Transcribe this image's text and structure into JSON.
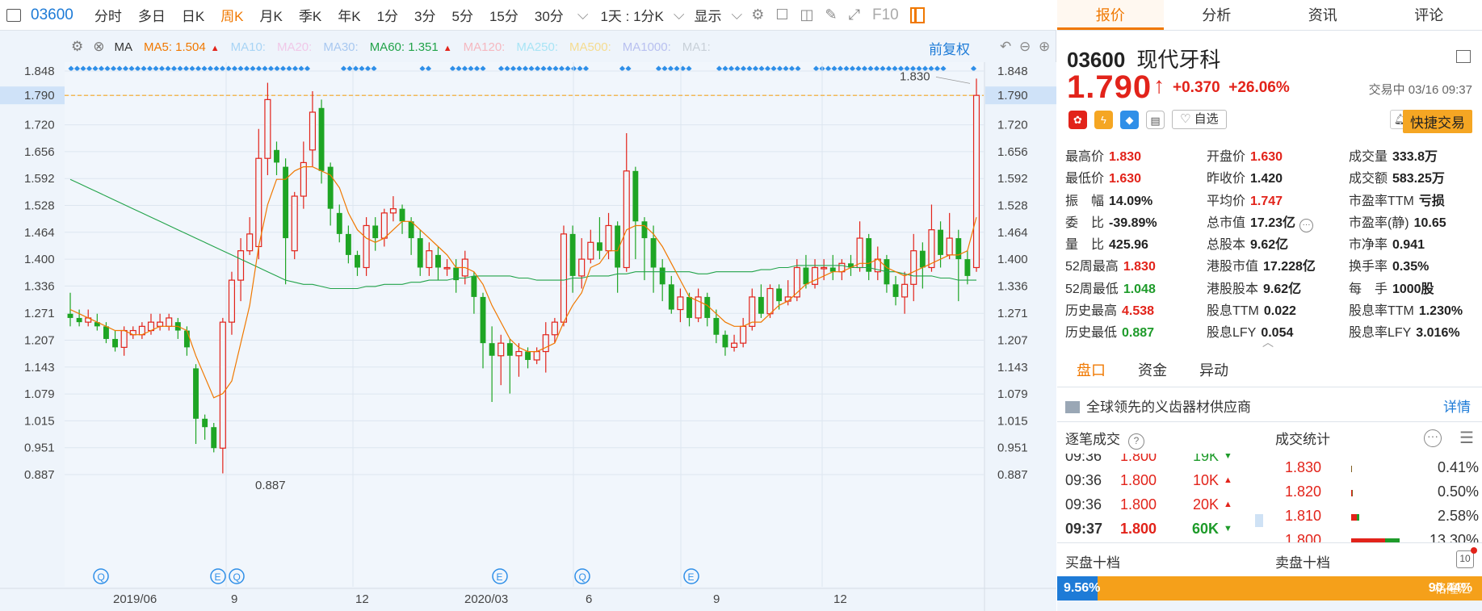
{
  "toolbar": {
    "code": "03600",
    "periods": [
      "分时",
      "多日",
      "日K",
      "周K",
      "月K",
      "季K",
      "年K",
      "1分",
      "3分",
      "5分",
      "15分",
      "30分"
    ],
    "active_period": "周K",
    "interval": "1天 : 1分K",
    "display": "显示",
    "f10": "F10"
  },
  "ma_bar": {
    "label": "MA",
    "items": [
      {
        "text": "MA5: 1.504",
        "color": "#f07800",
        "arrow": "▲"
      },
      {
        "text": "MA10:",
        "color": "#a8d4f5"
      },
      {
        "text": "MA20:",
        "color": "#f0c8e8"
      },
      {
        "text": "MA30:",
        "color": "#a8c8f0"
      },
      {
        "text": "MA60: 1.351",
        "color": "#22a34a",
        "arrow": "▲"
      },
      {
        "text": "MA120:",
        "color": "#f5b8c0"
      },
      {
        "text": "MA250:",
        "color": "#a8e4f5"
      },
      {
        "text": "MA500:",
        "color": "#f5dc90"
      },
      {
        "text": "MA1000:",
        "color": "#b8c0f0"
      },
      {
        "text": "MA1:",
        "color": "#c8d0d8"
      }
    ],
    "adjust": "前复权"
  },
  "chart_data": {
    "type": "candlestick",
    "y_axis_labels": [
      "1.848",
      "1.790",
      "1.720",
      "1.656",
      "1.592",
      "1.528",
      "1.464",
      "1.400",
      "1.336",
      "1.271",
      "1.207",
      "1.143",
      "1.079",
      "1.015",
      "0.951",
      "0.887"
    ],
    "current_price_label": "1.790",
    "high_annotation": "1.830",
    "low_annotation": "0.887",
    "x_labels": [
      "2019/06",
      "9",
      "12",
      "2020/03",
      "6",
      "9",
      "12"
    ],
    "event_markers": [
      "Q",
      "E",
      "Q",
      "E",
      "Q",
      "E"
    ],
    "ylim": [
      0.887,
      1.848
    ],
    "candles": [
      [
        1.27,
        1.26,
        1.32,
        1.24
      ],
      [
        1.26,
        1.25,
        1.28,
        1.24
      ],
      [
        1.25,
        1.26,
        1.28,
        1.24
      ],
      [
        1.25,
        1.24,
        1.27,
        1.23
      ],
      [
        1.24,
        1.21,
        1.25,
        1.2
      ],
      [
        1.21,
        1.19,
        1.23,
        1.18
      ],
      [
        1.19,
        1.23,
        1.24,
        1.17
      ],
      [
        1.22,
        1.23,
        1.24,
        1.21
      ],
      [
        1.22,
        1.24,
        1.25,
        1.21
      ],
      [
        1.23,
        1.25,
        1.27,
        1.22
      ],
      [
        1.24,
        1.25,
        1.27,
        1.23
      ],
      [
        1.24,
        1.26,
        1.27,
        1.23
      ],
      [
        1.25,
        1.23,
        1.26,
        1.21
      ],
      [
        1.23,
        1.19,
        1.24,
        1.17
      ],
      [
        1.14,
        1.02,
        1.15,
        0.96
      ],
      [
        1.02,
        1.0,
        1.03,
        0.97
      ],
      [
        1.0,
        0.95,
        1.01,
        0.94
      ],
      [
        0.95,
        1.25,
        1.26,
        0.89
      ],
      [
        1.25,
        1.35,
        1.37,
        1.22
      ],
      [
        1.35,
        1.42,
        1.45,
        1.3
      ],
      [
        1.42,
        1.46,
        1.5,
        1.41
      ],
      [
        1.43,
        1.64,
        1.71,
        1.4
      ],
      [
        1.64,
        1.78,
        1.82,
        1.6
      ],
      [
        1.66,
        1.63,
        1.68,
        1.6
      ],
      [
        1.62,
        1.45,
        1.64,
        1.34
      ],
      [
        1.42,
        1.55,
        1.56,
        1.4
      ],
      [
        1.55,
        1.63,
        1.68,
        1.52
      ],
      [
        1.66,
        1.75,
        1.8,
        1.62
      ],
      [
        1.76,
        1.61,
        1.78,
        1.58
      ],
      [
        1.62,
        1.52,
        1.63,
        1.48
      ],
      [
        1.51,
        1.46,
        1.53,
        1.44
      ],
      [
        1.46,
        1.41,
        1.48,
        1.39
      ],
      [
        1.41,
        1.38,
        1.42,
        1.36
      ],
      [
        1.38,
        1.48,
        1.5,
        1.36
      ],
      [
        1.48,
        1.45,
        1.5,
        1.42
      ],
      [
        1.45,
        1.51,
        1.52,
        1.43
      ],
      [
        1.51,
        1.52,
        1.55,
        1.49
      ],
      [
        1.52,
        1.49,
        1.53,
        1.46
      ],
      [
        1.49,
        1.45,
        1.5,
        1.41
      ],
      [
        1.45,
        1.38,
        1.47,
        1.36
      ],
      [
        1.38,
        1.42,
        1.44,
        1.36
      ],
      [
        1.41,
        1.38,
        1.43,
        1.35
      ],
      [
        1.38,
        1.38,
        1.4,
        1.36
      ],
      [
        1.38,
        1.35,
        1.4,
        1.32
      ],
      [
        1.36,
        1.4,
        1.42,
        1.34
      ],
      [
        1.36,
        1.31,
        1.37,
        1.27
      ],
      [
        1.31,
        1.2,
        1.32,
        1.14
      ],
      [
        1.2,
        1.17,
        1.24,
        1.06
      ],
      [
        1.17,
        1.2,
        1.22,
        1.1
      ],
      [
        1.2,
        1.17,
        1.21,
        1.08
      ],
      [
        1.17,
        1.18,
        1.2,
        1.12
      ],
      [
        1.18,
        1.16,
        1.19,
        1.14
      ],
      [
        1.16,
        1.18,
        1.19,
        1.15
      ],
      [
        1.18,
        1.22,
        1.25,
        1.13
      ],
      [
        1.22,
        1.25,
        1.26,
        1.2
      ],
      [
        1.25,
        1.46,
        1.48,
        1.24
      ],
      [
        1.46,
        1.36,
        1.48,
        1.32
      ],
      [
        1.36,
        1.4,
        1.45,
        1.33
      ],
      [
        1.4,
        1.44,
        1.47,
        1.39
      ],
      [
        1.44,
        1.42,
        1.5,
        1.4
      ],
      [
        1.42,
        1.48,
        1.51,
        1.4
      ],
      [
        1.48,
        1.38,
        1.49,
        1.32
      ],
      [
        1.38,
        1.61,
        1.7,
        1.37
      ],
      [
        1.61,
        1.49,
        1.62,
        1.4
      ],
      [
        1.49,
        1.45,
        1.5,
        1.35
      ],
      [
        1.45,
        1.38,
        1.48,
        1.32
      ],
      [
        1.38,
        1.34,
        1.4,
        1.3
      ],
      [
        1.34,
        1.28,
        1.36,
        1.27
      ],
      [
        1.28,
        1.31,
        1.33,
        1.25
      ],
      [
        1.31,
        1.26,
        1.32,
        1.24
      ],
      [
        1.26,
        1.31,
        1.33,
        1.25
      ],
      [
        1.31,
        1.26,
        1.32,
        1.24
      ],
      [
        1.26,
        1.22,
        1.28,
        1.2
      ],
      [
        1.22,
        1.19,
        1.23,
        1.17
      ],
      [
        1.19,
        1.2,
        1.22,
        1.18
      ],
      [
        1.2,
        1.24,
        1.26,
        1.19
      ],
      [
        1.24,
        1.31,
        1.33,
        1.23
      ],
      [
        1.31,
        1.27,
        1.34,
        1.26
      ],
      [
        1.27,
        1.33,
        1.34,
        1.26
      ],
      [
        1.33,
        1.3,
        1.34,
        1.28
      ],
      [
        1.3,
        1.31,
        1.35,
        1.29
      ],
      [
        1.31,
        1.38,
        1.4,
        1.3
      ],
      [
        1.38,
        1.34,
        1.41,
        1.33
      ],
      [
        1.34,
        1.38,
        1.4,
        1.33
      ],
      [
        1.38,
        1.38,
        1.4,
        1.35
      ],
      [
        1.38,
        1.37,
        1.41,
        1.35
      ],
      [
        1.37,
        1.39,
        1.4,
        1.35
      ],
      [
        1.39,
        1.38,
        1.41,
        1.36
      ],
      [
        1.38,
        1.45,
        1.49,
        1.37
      ],
      [
        1.45,
        1.37,
        1.46,
        1.35
      ],
      [
        1.37,
        1.4,
        1.43,
        1.35
      ],
      [
        1.4,
        1.34,
        1.41,
        1.32
      ],
      [
        1.34,
        1.31,
        1.36,
        1.29
      ],
      [
        1.31,
        1.34,
        1.37,
        1.27
      ],
      [
        1.34,
        1.42,
        1.46,
        1.3
      ],
      [
        1.42,
        1.38,
        1.44,
        1.33
      ],
      [
        1.38,
        1.47,
        1.53,
        1.37
      ],
      [
        1.47,
        1.41,
        1.49,
        1.38
      ],
      [
        1.41,
        1.45,
        1.51,
        1.4
      ],
      [
        1.45,
        1.4,
        1.47,
        1.3
      ],
      [
        1.4,
        1.36,
        1.42,
        1.34
      ],
      [
        1.38,
        1.79,
        1.83,
        1.37
      ]
    ],
    "ma5": [
      1.28,
      1.27,
      1.26,
      1.25,
      1.24,
      1.23,
      1.23,
      1.22,
      1.22,
      1.23,
      1.24,
      1.24,
      1.24,
      1.23,
      1.17,
      1.12,
      1.07,
      1.08,
      1.11,
      1.2,
      1.29,
      1.43,
      1.53,
      1.59,
      1.59,
      1.61,
      1.62,
      1.62,
      1.61,
      1.6,
      1.57,
      1.51,
      1.47,
      1.45,
      1.44,
      1.45,
      1.47,
      1.49,
      1.49,
      1.47,
      1.45,
      1.43,
      1.41,
      1.38,
      1.38,
      1.37,
      1.34,
      1.29,
      1.25,
      1.21,
      1.19,
      1.18,
      1.18,
      1.19,
      1.2,
      1.25,
      1.29,
      1.32,
      1.38,
      1.39,
      1.42,
      1.42,
      1.47,
      1.48,
      1.48,
      1.46,
      1.43,
      1.39,
      1.35,
      1.31,
      1.3,
      1.29,
      1.27,
      1.25,
      1.24,
      1.24,
      1.25,
      1.25,
      1.27,
      1.29,
      1.3,
      1.32,
      1.34,
      1.35,
      1.36,
      1.37,
      1.37,
      1.38,
      1.39,
      1.39,
      1.4,
      1.38,
      1.37,
      1.36,
      1.37,
      1.38,
      1.39,
      1.4,
      1.41,
      1.41,
      1.42,
      1.5
    ],
    "ma60": [
      1.59,
      1.58,
      1.57,
      1.56,
      1.55,
      1.54,
      1.53,
      1.52,
      1.51,
      1.5,
      1.49,
      1.48,
      1.47,
      1.46,
      1.45,
      1.44,
      1.43,
      1.42,
      1.41,
      1.4,
      1.39,
      1.38,
      1.37,
      1.36,
      1.35,
      1.345,
      1.34,
      1.34,
      1.335,
      1.33,
      1.33,
      1.33,
      1.33,
      1.335,
      1.335,
      1.34,
      1.34,
      1.34,
      1.345,
      1.345,
      1.35,
      1.35,
      1.35,
      1.355,
      1.355,
      1.36,
      1.36,
      1.36,
      1.36,
      1.36,
      1.355,
      1.355,
      1.35,
      1.35,
      1.35,
      1.35,
      1.355,
      1.355,
      1.36,
      1.36,
      1.36,
      1.365,
      1.365,
      1.37,
      1.37,
      1.37,
      1.37,
      1.37,
      1.37,
      1.37,
      1.365,
      1.365,
      1.37,
      1.37,
      1.37,
      1.37,
      1.37,
      1.375,
      1.375,
      1.38,
      1.38,
      1.385,
      1.385,
      1.385,
      1.385,
      1.385,
      1.385,
      1.38,
      1.38,
      1.38,
      1.375,
      1.37,
      1.37,
      1.365,
      1.36,
      1.36,
      1.36,
      1.355,
      1.355,
      1.35,
      1.35,
      1.35
    ]
  },
  "quote": {
    "tabs": [
      "报价",
      "分析",
      "资讯",
      "评论"
    ],
    "code": "03600",
    "name": "现代牙科",
    "price": "1.790",
    "change": "+0.370",
    "change_pct": "+26.06%",
    "status": "交易中 03/16 09:37",
    "watch_label": "自选",
    "quick_trade": "快捷交易",
    "rows": [
      [
        [
          "最高价",
          "1.830",
          "red"
        ],
        [
          "开盘价",
          "1.630",
          "red"
        ],
        [
          "成交量",
          "333.8万",
          "dark"
        ]
      ],
      [
        [
          "最低价",
          "1.630",
          "red"
        ],
        [
          "昨收价",
          "1.420",
          "dark"
        ],
        [
          "成交额",
          "583.25万",
          "dark"
        ]
      ],
      [
        [
          "振　幅",
          "14.09%",
          "dark"
        ],
        [
          "平均价",
          "1.747",
          "red"
        ],
        [
          "市盈率TTM",
          "亏损",
          "dark"
        ]
      ],
      [
        [
          "委　比",
          "-39.89%",
          "dark"
        ],
        [
          "总市值",
          "17.23亿",
          "dark"
        ],
        [
          "市盈率(静)",
          "10.65",
          "dark"
        ]
      ],
      [
        [
          "量　比",
          "425.96",
          "dark"
        ],
        [
          "总股本",
          "9.62亿",
          "dark"
        ],
        [
          "市净率",
          "0.941",
          "dark"
        ]
      ],
      [
        [
          "52周最高",
          "1.830",
          "red"
        ],
        [
          "港股市值",
          "17.228亿",
          "dark"
        ],
        [
          "换手率",
          "0.35%",
          "dark"
        ]
      ],
      [
        [
          "52周最低",
          "1.048",
          "green"
        ],
        [
          "港股股本",
          "9.62亿",
          "dark"
        ],
        [
          "每　手",
          "1000股",
          "dark"
        ]
      ],
      [
        [
          "历史最高",
          "4.538",
          "red"
        ],
        [
          "股息TTM",
          "0.022",
          "dark"
        ],
        [
          "股息率TTM",
          "1.230%",
          "dark"
        ]
      ],
      [
        [
          "历史最低",
          "0.887",
          "green"
        ],
        [
          "股息LFY",
          "0.054",
          "dark"
        ],
        [
          "股息率LFY",
          "3.016%",
          "dark"
        ]
      ]
    ]
  },
  "panel": {
    "tabs": [
      "盘口",
      "资金",
      "异动"
    ],
    "desc": "全球领先的义齿器材供应商",
    "more": "详情",
    "ticks_title": "逐笔成交",
    "deal_title": "成交统计",
    "ticks": [
      [
        "09:36",
        "1.800",
        "19K",
        "▼",
        "green"
      ],
      [
        "09:36",
        "1.800",
        "10K",
        "▲",
        "red"
      ],
      [
        "09:36",
        "1.800",
        "20K",
        "▲",
        "red"
      ],
      [
        "09:37",
        "1.800",
        "60K",
        "▼",
        "green"
      ]
    ],
    "deals": [
      [
        "1.830",
        "0.41%"
      ],
      [
        "1.820",
        "0.50%"
      ],
      [
        "1.810",
        "2.58%"
      ],
      [
        "1.800",
        "13.30%"
      ]
    ],
    "buy_title": "买盘十档",
    "sell_title": "卖盘十档",
    "buy_pct": "9.56%",
    "sell_pct": "90.44%",
    "count_badge": "10",
    "watermark": "格隆汇"
  }
}
